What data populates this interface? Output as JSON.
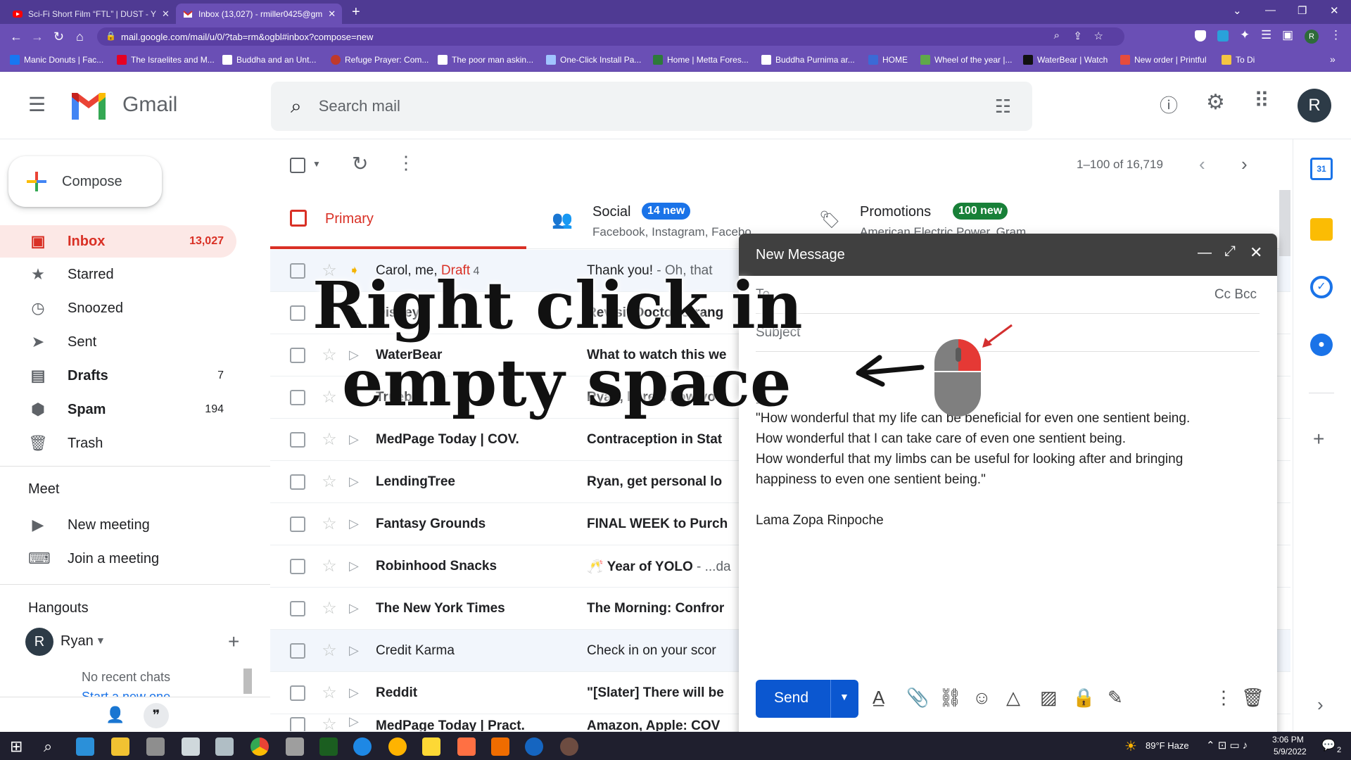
{
  "browser": {
    "tabs": [
      {
        "title": "Sci-Fi Short Film “FTL” | DUST - Y",
        "active": false
      },
      {
        "title": "Inbox (13,027) - rmiller0425@gm",
        "active": true
      }
    ],
    "new_tab": "+",
    "url": "mail.google.com/mail/u/0/?tab=rm&ogbl#inbox?compose=new",
    "profile_initial": "R",
    "bookmarks": [
      "Manic Donuts | Fac...",
      "The Israelites and M...",
      "Buddha and an Unt...",
      "Refuge Prayer: Com...",
      "The poor man askin...",
      "One-Click Install Pa...",
      "Home | Metta Fores...",
      "Buddha Purnima ar...",
      "HOME",
      "Wheel of the year |...",
      "WaterBear | Watch",
      "New order | Printful",
      "To Di"
    ],
    "more_bookmarks": "»"
  },
  "gmail": {
    "logo_text": "Gmail",
    "search_placeholder": "Search mail",
    "avatar_initial": "R",
    "compose_label": "Compose",
    "nav": [
      {
        "label": "Inbox",
        "count": "13,027",
        "icon": "inbox-icon",
        "selected": true
      },
      {
        "label": "Starred",
        "count": "",
        "icon": "star-icon"
      },
      {
        "label": "Snoozed",
        "count": "",
        "icon": "clock-icon"
      },
      {
        "label": "Sent",
        "count": "",
        "icon": "send-icon"
      },
      {
        "label": "Drafts",
        "count": "7",
        "icon": "draft-icon"
      },
      {
        "label": "Spam",
        "count": "194",
        "icon": "spam-icon"
      },
      {
        "label": "Trash",
        "count": "",
        "icon": "trash-icon"
      }
    ],
    "meet": {
      "title": "Meet",
      "new_meeting": "New meeting",
      "join_meeting": "Join a meeting"
    },
    "hangouts": {
      "title": "Hangouts",
      "user": "Ryan",
      "user_initial": "R",
      "no_recent": "No recent chats",
      "start_new": "Start a new one"
    },
    "pagination": "1–100 of 16,719",
    "inbox_tabs": [
      {
        "label": "Primary",
        "badge": "",
        "sub": ""
      },
      {
        "label": "Social",
        "badge": "14 new",
        "sub": "Facebook, Instagram, Facebo"
      },
      {
        "label": "Promotions",
        "badge": "100 new",
        "sub": "American Electric Power, Gram"
      }
    ],
    "rows": [
      {
        "sender_parts": [
          "Carol, me, ",
          "Draft",
          " 4"
        ],
        "subject": "Thank you!",
        "snippet": " - Oh, that",
        "read": true,
        "important": true
      },
      {
        "sender": "Disney",
        "subject": "Revisit Doctor Strang",
        "snippet": "",
        "read": false
      },
      {
        "sender": "WaterBear",
        "subject": "What to watch this we",
        "snippet": "",
        "read": false
      },
      {
        "sender": "Truebill",
        "subject": "Ryan, here's how you",
        "snippet": "",
        "read": false
      },
      {
        "sender": "MedPage Today | COV.",
        "subject": "Contraception in Stat",
        "snippet": "",
        "read": false
      },
      {
        "sender": "LendingTree",
        "subject": "Ryan, get personal lo",
        "snippet": "",
        "read": false
      },
      {
        "sender": "Fantasy Grounds",
        "subject": "FINAL WEEK to Purch",
        "snippet": "",
        "read": false
      },
      {
        "sender": "Robinhood Snacks",
        "subject": "🥂 Year of YOLO",
        "snippet": " - ...da",
        "read": false
      },
      {
        "sender": "The New York Times",
        "subject": "The Morning: Confror",
        "snippet": "",
        "read": false
      },
      {
        "sender": "Credit Karma",
        "subject": "Check in on your scor",
        "snippet": "",
        "read": true
      },
      {
        "sender": "Reddit",
        "subject": "\"[Slater] There will be",
        "snippet": "",
        "read": false
      },
      {
        "sender": "MedPage Today | Pract.",
        "subject": "Amazon, Apple: COV",
        "snippet": "",
        "read": false
      }
    ]
  },
  "compose": {
    "title": "New Message",
    "to_label": "To",
    "cc_bcc": "Cc Bcc",
    "subject_placeholder": "Subject",
    "signature_dash": "--",
    "body_lines": [
      "\"How wonderful that my life can be beneficial for even one sentient being.",
      "How wonderful that I can take care of even one sentient being.",
      "How wonderful that my limbs can be useful for looking after and bringing",
      "happiness to even one sentient being.\""
    ],
    "signature_name": "Lama Zopa Rinpoche",
    "send_label": "Send"
  },
  "overlay": {
    "line1": "Right click in",
    "line2": "empty space"
  },
  "taskbar": {
    "weather": "89°F  Haze",
    "time": "3:06 PM",
    "date": "5/9/2022",
    "notifications": "2"
  },
  "colors": {
    "browser_purple": "#6a4fb5",
    "gmail_red": "#d93025",
    "send_blue": "#0b57d0",
    "compose_header": "#404040"
  }
}
